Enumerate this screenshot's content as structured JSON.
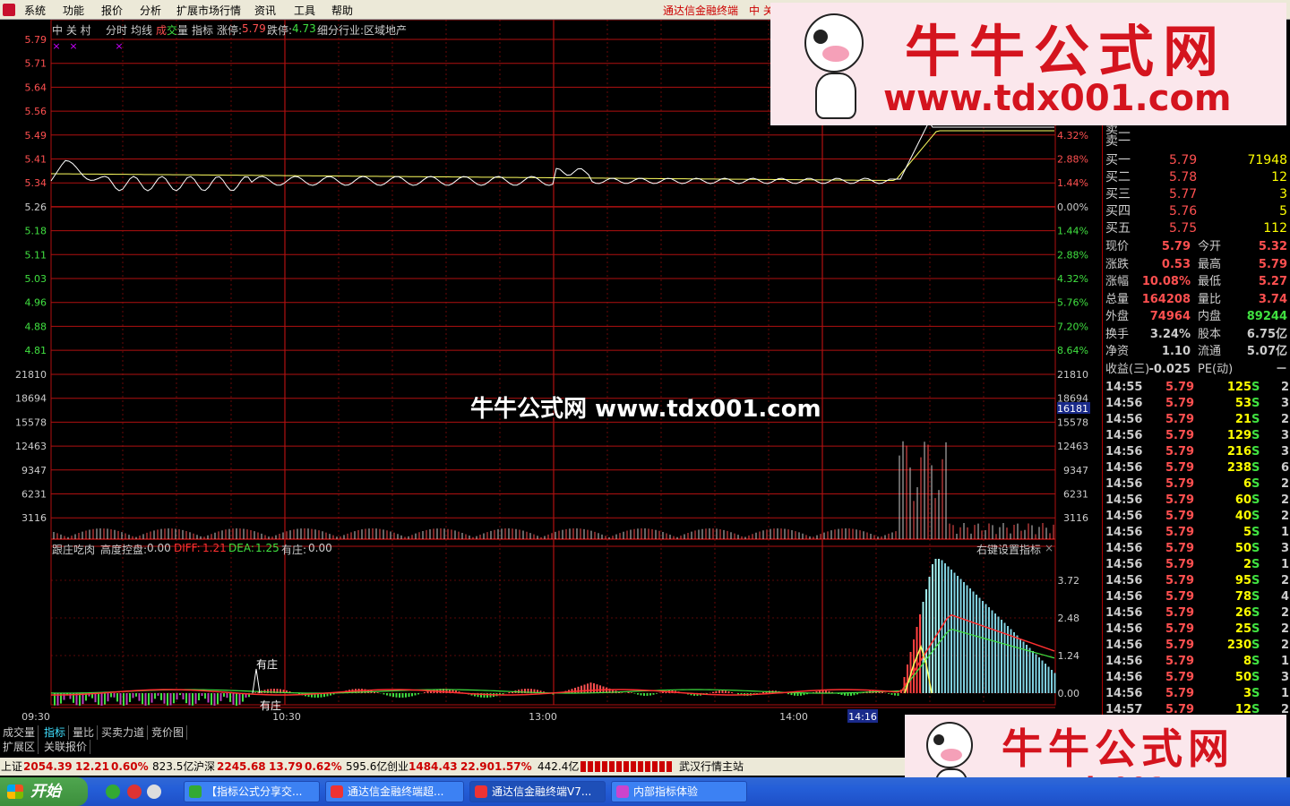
{
  "menu": {
    "items": [
      "系统",
      "功能",
      "报价",
      "分析",
      "扩展市场行情",
      "资讯",
      "工具",
      "帮助"
    ],
    "app_title": "通达信金融终端",
    "app_title_extra": "中 关"
  },
  "header": {
    "stock": "中 关 村",
    "tab_fenshi": "分时",
    "tab_junxian": "均线",
    "tab_chengjiao_a": "成",
    "tab_chengjiao_b": "交",
    "tab_chengjiao_c": "量",
    "tab_zhibiao": "指标",
    "zhangting_label": "涨停:",
    "zhangting_value": "5.79",
    "dieting_label": "跌停:",
    "dieting_value": "4.73",
    "industry": "细分行业:区域地产"
  },
  "price_axis": {
    "left": [
      "5.79",
      "5.71",
      "5.64",
      "5.56",
      "5.49",
      "5.41",
      "5.34",
      "5.26",
      "5.18",
      "5.11",
      "5.03",
      "4.96",
      "4.88",
      "4.81"
    ],
    "right": [
      "4.32%",
      "2.88%",
      "1.44%",
      "0.00%",
      "1.44%",
      "2.88%",
      "4.32%",
      "5.76%",
      "7.20%",
      "8.64%"
    ]
  },
  "volume_axis": {
    "left": [
      "21810",
      "18694",
      "15578",
      "12463",
      "9347",
      "6231",
      "3116"
    ],
    "right": [
      "21810",
      "18694",
      "15578",
      "12463",
      "9347",
      "6231",
      "3116"
    ],
    "highlight": "16181"
  },
  "indicator": {
    "name": "跟庄吃肉",
    "gaodu_label": "高度控盘:",
    "gaodu_value": "0.00",
    "diff_label": "DIFF:",
    "diff_value": "1.21",
    "dea_label": "DEA:",
    "dea_value": "1.25",
    "youzhuang_label": "有庄:",
    "youzhuang_value": "0.00",
    "settings": "右键设置指标",
    "axis": [
      "3.72",
      "2.48",
      "1.24",
      "0.00"
    ],
    "mark1": "有庄",
    "mark2": "有庄"
  },
  "time_axis": {
    "labels": [
      "09:30",
      "10:30",
      "13:00",
      "14:00"
    ],
    "cursor": "14:16"
  },
  "quote": {
    "sell_top": "卖二",
    "sell_one": "卖一",
    "buys": [
      {
        "label": "买一",
        "price": "5.79",
        "vol": "71948"
      },
      {
        "label": "买二",
        "price": "5.78",
        "vol": "12"
      },
      {
        "label": "买三",
        "price": "5.77",
        "vol": "3"
      },
      {
        "label": "买四",
        "price": "5.76",
        "vol": "5"
      },
      {
        "label": "买五",
        "price": "5.75",
        "vol": "112"
      }
    ],
    "stats": [
      {
        "l1": "现价",
        "v1": "5.79",
        "l2": "今开",
        "v2": "5.32"
      },
      {
        "l1": "涨跌",
        "v1": "0.53",
        "l2": "最高",
        "v2": "5.79"
      },
      {
        "l1": "涨幅",
        "v1": "10.08%",
        "l2": "最低",
        "v2": "5.27"
      },
      {
        "l1": "总量",
        "v1": "164208",
        "l2": "量比",
        "v2": "3.74"
      },
      {
        "l1": "外盘",
        "v1": "74964",
        "l2": "内盘",
        "v2": "89244"
      },
      {
        "l1": "换手",
        "v1": "3.24%",
        "l2": "股本",
        "v2": "6.75亿"
      },
      {
        "l1": "净资",
        "v1": "1.10",
        "l2": "流通",
        "v2": "5.07亿"
      },
      {
        "l1": "收益(三)",
        "v1": "-0.025",
        "l2": "PE(动)",
        "v2": "－"
      }
    ]
  },
  "ticks": [
    {
      "t": "14:55",
      "p": "5.79",
      "v": "125",
      "s": "S",
      "n": "2"
    },
    {
      "t": "14:56",
      "p": "5.79",
      "v": "53",
      "s": "S",
      "n": "3"
    },
    {
      "t": "14:56",
      "p": "5.79",
      "v": "21",
      "s": "S",
      "n": "2"
    },
    {
      "t": "14:56",
      "p": "5.79",
      "v": "129",
      "s": "S",
      "n": "3"
    },
    {
      "t": "14:56",
      "p": "5.79",
      "v": "216",
      "s": "S",
      "n": "3"
    },
    {
      "t": "14:56",
      "p": "5.79",
      "v": "238",
      "s": "S",
      "n": "6"
    },
    {
      "t": "14:56",
      "p": "5.79",
      "v": "6",
      "s": "S",
      "n": "2"
    },
    {
      "t": "14:56",
      "p": "5.79",
      "v": "60",
      "s": "S",
      "n": "2"
    },
    {
      "t": "14:56",
      "p": "5.79",
      "v": "40",
      "s": "S",
      "n": "2"
    },
    {
      "t": "14:56",
      "p": "5.79",
      "v": "5",
      "s": "S",
      "n": "1"
    },
    {
      "t": "14:56",
      "p": "5.79",
      "v": "50",
      "s": "S",
      "n": "3"
    },
    {
      "t": "14:56",
      "p": "5.79",
      "v": "2",
      "s": "S",
      "n": "1"
    },
    {
      "t": "14:56",
      "p": "5.79",
      "v": "95",
      "s": "S",
      "n": "2"
    },
    {
      "t": "14:56",
      "p": "5.79",
      "v": "78",
      "s": "S",
      "n": "4"
    },
    {
      "t": "14:56",
      "p": "5.79",
      "v": "26",
      "s": "S",
      "n": "2"
    },
    {
      "t": "14:56",
      "p": "5.79",
      "v": "25",
      "s": "S",
      "n": "2"
    },
    {
      "t": "14:56",
      "p": "5.79",
      "v": "230",
      "s": "S",
      "n": "2"
    },
    {
      "t": "14:56",
      "p": "5.79",
      "v": "8",
      "s": "S",
      "n": "1"
    },
    {
      "t": "14:56",
      "p": "5.79",
      "v": "50",
      "s": "S",
      "n": "3"
    },
    {
      "t": "14:56",
      "p": "5.79",
      "v": "3",
      "s": "S",
      "n": "1"
    },
    {
      "t": "14:57",
      "p": "5.79",
      "v": "12",
      "s": "S",
      "n": "2"
    }
  ],
  "bottom_tabs": [
    "成交量",
    "指标",
    "量比",
    "买卖力道",
    "竞价图"
  ],
  "ext_tabs": [
    "扩展区",
    "关联报价"
  ],
  "status": {
    "sh_label": "上证",
    "sh_value": "2054.39",
    "sh_change": "12.21",
    "sh_pct": "0.60%",
    "sh_amount": "823.5亿",
    "sz_label": "沪深",
    "sz_value": "2245.68",
    "sz_change": "13.79",
    "sz_pct": "0.62%",
    "sz_amount": "595.6亿",
    "cy_label": "创业",
    "cy_value": "1484.43",
    "cy_change": "22.90",
    "cy_pct": "1.57%",
    "cy_amount": "442.4亿",
    "station": "武汉行情主站"
  },
  "taskbar": {
    "start": "开始",
    "buttons": [
      "【指标公式分享交...",
      "通达信金融终端超...",
      "通达信金融终端V7...",
      "内部指标体验"
    ]
  },
  "watermark": {
    "title": "牛牛公式网",
    "url": "www.tdx001.com",
    "center": "牛牛公式网 www.tdx001.com"
  },
  "colors": {
    "up": "#ff5050",
    "down": "#40e040",
    "grid": "#b01010",
    "text": "#c0c0c0",
    "yellow": "#ffff00",
    "price_line": "#ffffff",
    "avg_line": "#ffff60"
  }
}
